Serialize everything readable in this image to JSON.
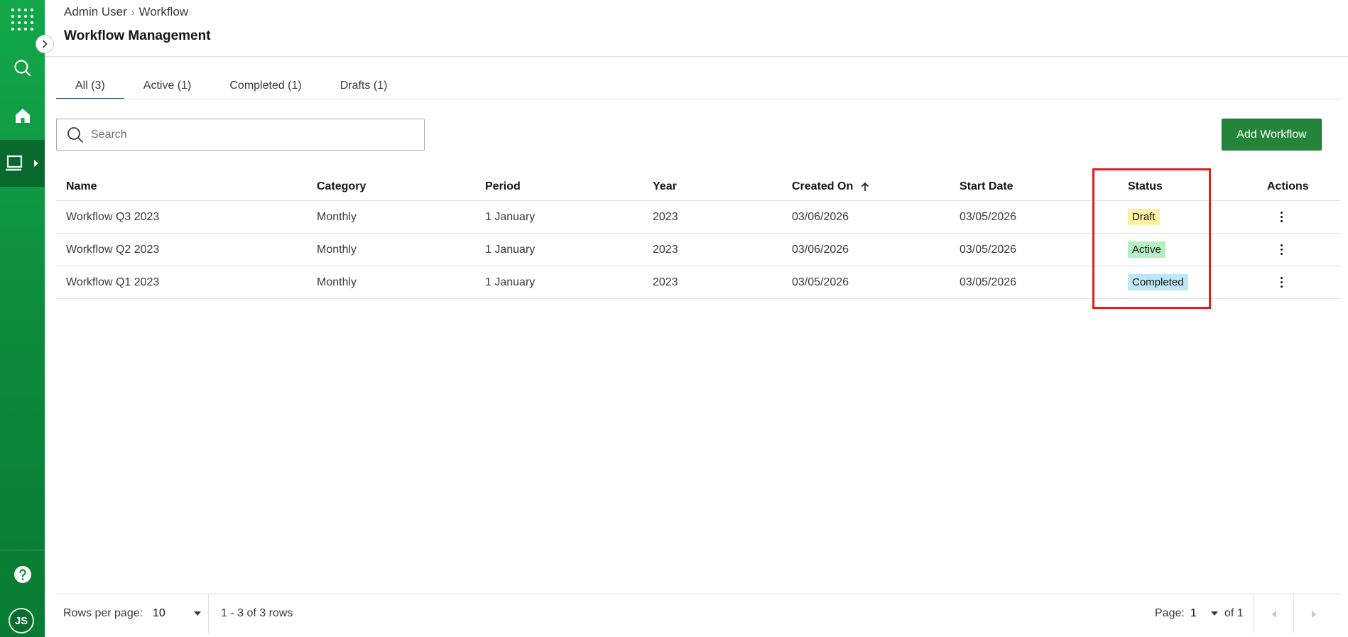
{
  "colors": {
    "sidebar_green": "#13a84a",
    "primary_button": "#24843a",
    "tab_indicator": "#2b4a6b",
    "highlight": "#e01e1e",
    "badge_draft_bg": "#fff1a3",
    "badge_active_bg": "#b6efc4",
    "badge_completed_bg": "#bde7f7"
  },
  "sidebar": {
    "items": [
      {
        "name": "app-launcher",
        "icon": "grid-dots-icon"
      },
      {
        "name": "search",
        "icon": "search-icon"
      },
      {
        "name": "home",
        "icon": "home-icon"
      },
      {
        "name": "workflow",
        "icon": "laptop-icon",
        "selected": true
      },
      {
        "name": "help",
        "icon": "help-icon"
      }
    ],
    "avatar_initials": "JS"
  },
  "breadcrumb": {
    "items": [
      "Admin User",
      "Workflow"
    ]
  },
  "page": {
    "title": "Workflow Management"
  },
  "tabs": [
    {
      "label": "All (3)",
      "active": true
    },
    {
      "label": "Active (1)",
      "active": false
    },
    {
      "label": "Completed (1)",
      "active": false
    },
    {
      "label": "Drafts (1)",
      "active": false
    }
  ],
  "search": {
    "placeholder": "Search",
    "value": ""
  },
  "toolbar": {
    "add_label": "Add Workflow"
  },
  "table": {
    "columns": [
      "Name",
      "Category",
      "Period",
      "Year",
      "Created On",
      "Start Date",
      "Status",
      "Actions"
    ],
    "sorted_column": "Created On",
    "sort_direction": "ascending",
    "rows": [
      {
        "name": "Workflow Q3 2023",
        "category": "Monthly",
        "period": "1 January",
        "year": "2023",
        "created_on": "03/06/2026",
        "start_date": "03/05/2026",
        "status": "Draft",
        "status_color": "#fff1a3"
      },
      {
        "name": "Workflow Q2 2023",
        "category": "Monthly",
        "period": "1 January",
        "year": "2023",
        "created_on": "03/06/2026",
        "start_date": "03/05/2026",
        "status": "Active",
        "status_color": "#b6efc4"
      },
      {
        "name": "Workflow Q1 2023",
        "category": "Monthly",
        "period": "1 January",
        "year": "2023",
        "created_on": "03/05/2026",
        "start_date": "03/05/2026",
        "status": "Completed",
        "status_color": "#bde7f7"
      }
    ]
  },
  "pagination": {
    "rows_per_page_label": "Rows per page:",
    "rows_per_page_value": "10",
    "range_text": "1 - 3 of 3 rows",
    "page_label": "Page:",
    "page_value": "1",
    "page_total_text": "of 1"
  }
}
